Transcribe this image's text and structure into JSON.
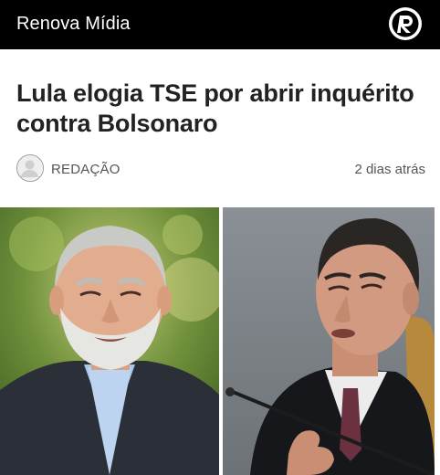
{
  "header": {
    "site_name": "Renova Mídia",
    "logo_icon": "registered-r-logo",
    "background": "#000000"
  },
  "article": {
    "headline": "Lula elogia TSE por abrir inquérito contra Bolsonaro",
    "author": "REDAÇÃO",
    "time_ago": "2 dias atrás",
    "author_avatar_icon": "user-avatar-icon"
  },
  "images": {
    "left": "man-with-white-beard-photo",
    "right": "judge-in-black-robe-photo"
  }
}
